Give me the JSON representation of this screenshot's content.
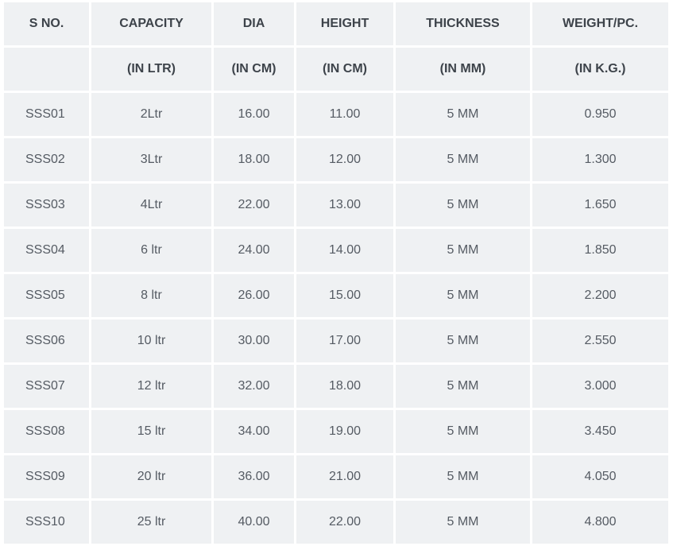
{
  "table": {
    "headers": [
      "S NO.",
      "CAPACITY",
      "DIA",
      "HEIGHT",
      "THICKNESS",
      "WEIGHT/PC."
    ],
    "units": [
      "",
      "(IN LTR)",
      "(IN CM)",
      "(IN CM)",
      "(IN MM)",
      "(IN K.G.)"
    ],
    "rows": [
      [
        "SSS01",
        "2Ltr",
        "16.00",
        "11.00",
        "5 MM",
        "0.950"
      ],
      [
        "SSS02",
        "3Ltr",
        "18.00",
        "12.00",
        "5 MM",
        "1.300"
      ],
      [
        "SSS03",
        "4Ltr",
        "22.00",
        "13.00",
        "5 MM",
        "1.650"
      ],
      [
        "SSS04",
        "6 ltr",
        "24.00",
        "14.00",
        "5 MM",
        "1.850"
      ],
      [
        "SSS05",
        "8 ltr",
        "26.00",
        "15.00",
        "5 MM",
        "2.200"
      ],
      [
        "SSS06",
        "10 ltr",
        "30.00",
        "17.00",
        "5 MM",
        "2.550"
      ],
      [
        "SSS07",
        "12 ltr",
        "32.00",
        "18.00",
        "5 MM",
        "3.000"
      ],
      [
        "SSS08",
        "15 ltr",
        "34.00",
        "19.00",
        "5 MM",
        "3.450"
      ],
      [
        "SSS09",
        "20 ltr",
        "36.00",
        "21.00",
        "5 MM",
        "4.050"
      ],
      [
        "SSS10",
        "25 ltr",
        "40.00",
        "22.00",
        "5 MM",
        "4.800"
      ]
    ]
  }
}
